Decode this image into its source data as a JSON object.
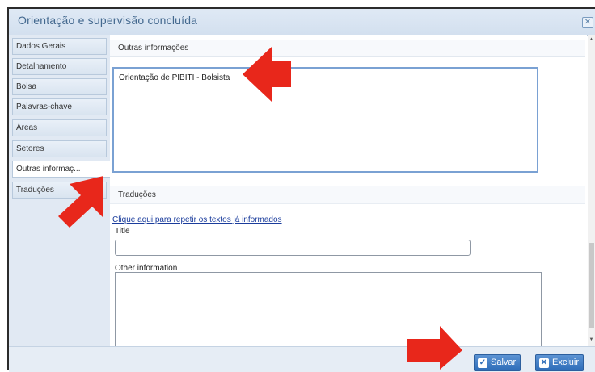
{
  "dialog": {
    "title": "Orientação e supervisão concluída",
    "close_icon": "close-icon"
  },
  "sidebar": {
    "tabs": [
      {
        "label": "Dados Gerais"
      },
      {
        "label": "Detalhamento"
      },
      {
        "label": "Bolsa"
      },
      {
        "label": "Palavras-chave"
      },
      {
        "label": "Áreas"
      },
      {
        "label": "Setores"
      },
      {
        "label": "Outras informaç..."
      },
      {
        "label": "Traduções"
      }
    ],
    "active_index": 6
  },
  "main": {
    "outras_header": "Outras informações",
    "outras_text": "Orientação de PIBITI - Bolsista",
    "traducoes_header": "Traduções",
    "repeat_link": "Clique aqui para repetir os textos já informados",
    "title_label": "Title",
    "title_value": "",
    "other_info_label": "Other information",
    "other_info_value": ""
  },
  "footer": {
    "save_label": "Salvar",
    "delete_label": "Excluir"
  },
  "colors": {
    "arrow_red": "#e8271b",
    "accent_blue": "#2e6db9",
    "title_text": "#44698f"
  }
}
